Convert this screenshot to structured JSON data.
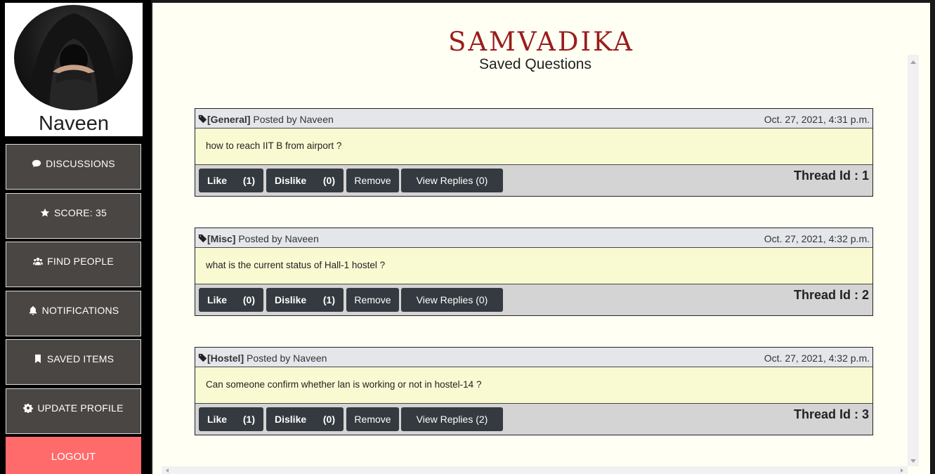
{
  "profile": {
    "name": "Naveen"
  },
  "nav": [
    {
      "label": "DISCUSSIONS",
      "icon": "comment-icon"
    },
    {
      "label": "SCORE: 35",
      "icon": "star-icon"
    },
    {
      "label": "FIND PEOPLE",
      "icon": "users-icon"
    },
    {
      "label": "NOTIFICATIONS",
      "icon": "bell-icon"
    },
    {
      "label": "SAVED ITEMS",
      "icon": "bookmark-icon"
    },
    {
      "label": "UPDATE PROFILE",
      "icon": "gear-icon"
    }
  ],
  "logout_label": "LOGOUT",
  "header": {
    "app_title": "SAMVADIKA",
    "page_title": "Saved Questions"
  },
  "threads": [
    {
      "category": "[General]",
      "posted_by": "Posted by Naveen",
      "date": "Oct. 27, 2021, 4:31 p.m.",
      "question": "how to reach IIT B from airport ?",
      "like_label": "Like",
      "like_count": "(1)",
      "dislike_label": "Dislike",
      "dislike_count": "(0)",
      "remove_label": "Remove",
      "replies_label": "View Replies (0)",
      "thread_id": "Thread Id : 1"
    },
    {
      "category": "[Misc]",
      "posted_by": "Posted by Naveen",
      "date": "Oct. 27, 2021, 4:32 p.m.",
      "question": "what is the current status of Hall-1 hostel ?",
      "like_label": "Like",
      "like_count": "(0)",
      "dislike_label": "Dislike",
      "dislike_count": "(1)",
      "remove_label": "Remove",
      "replies_label": "View Replies (0)",
      "thread_id": "Thread Id : 2"
    },
    {
      "category": "[Hostel]",
      "posted_by": "Posted by Naveen",
      "date": "Oct. 27, 2021, 4:32 p.m.",
      "question": "Can someone confirm whether lan is working or not in hostel-14 ?",
      "like_label": "Like",
      "like_count": "(1)",
      "dislike_label": "Dislike",
      "dislike_count": "(0)",
      "remove_label": "Remove",
      "replies_label": "View Replies (2)",
      "thread_id": "Thread Id : 3"
    }
  ],
  "colors": {
    "title": "#9a1c1c",
    "nav_bg": "#4a4643",
    "logout_bg": "#ff6b6b",
    "button_bg": "#343a40",
    "question_bg": "#fafad2",
    "main_bg": "#fffff4"
  }
}
